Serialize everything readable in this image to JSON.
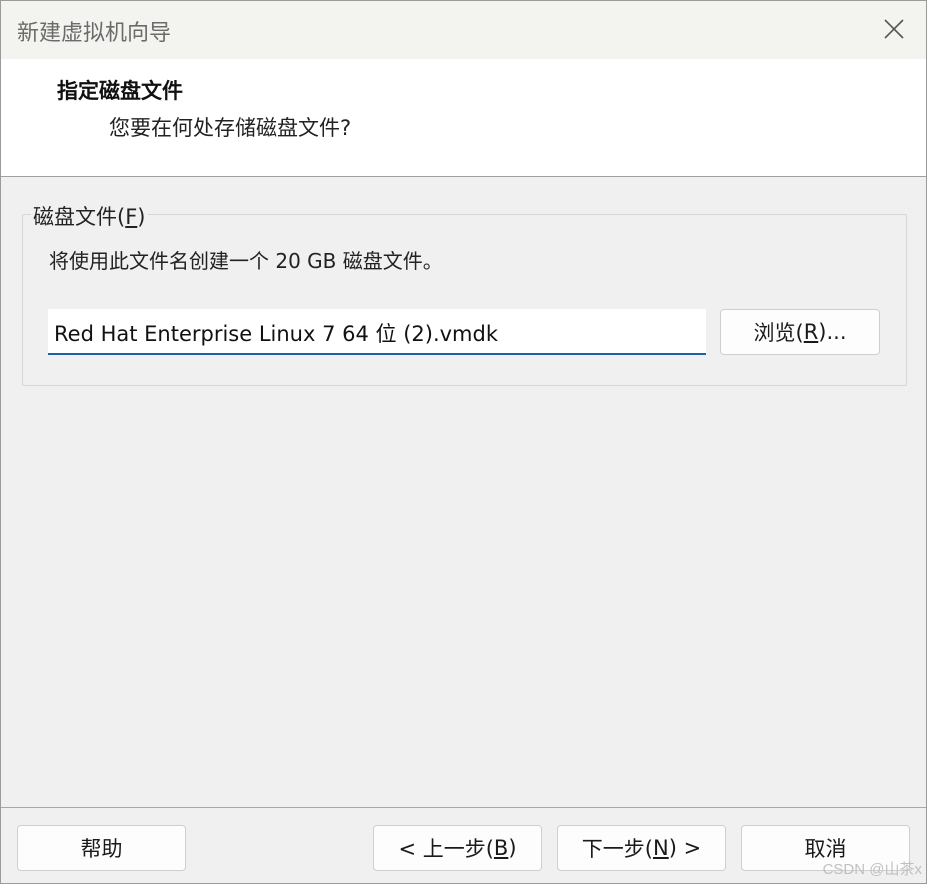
{
  "window": {
    "title": "新建虚拟机向导"
  },
  "header": {
    "title": "指定磁盘文件",
    "subtitle": "您要在何处存储磁盘文件?"
  },
  "disk_group": {
    "legend_prefix": "磁盘文件(",
    "legend_mnemonic": "F",
    "legend_suffix": ")",
    "description": "将使用此文件名创建一个 20 GB 磁盘文件。",
    "file_value": "Red Hat Enterprise Linux 7 64 位 (2).vmdk",
    "browse_prefix": "浏览(",
    "browse_mnemonic": "R",
    "browse_suffix": ")..."
  },
  "footer": {
    "help_label": "帮助",
    "back_prefix": "< 上一步(",
    "back_mnemonic": "B",
    "back_suffix": ")",
    "next_prefix": "下一步(",
    "next_mnemonic": "N",
    "next_suffix": ") >",
    "cancel_label": "取消"
  },
  "watermark": "CSDN @山茶x",
  "icons": {
    "close": "close-icon"
  },
  "colors": {
    "input_underline": "#1f5fa8",
    "header_bg": "#ffffff",
    "window_bg": "#f0f0f0"
  }
}
